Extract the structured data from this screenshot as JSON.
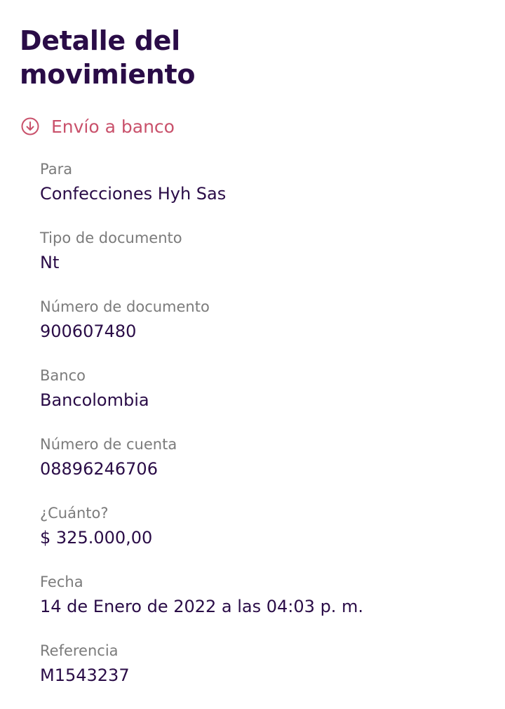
{
  "header": {
    "title_line1": "Detalle del",
    "title_line2": "movimiento"
  },
  "movement": {
    "icon": "arrow-down-circle-icon",
    "label": "Envío a banco",
    "accent_color": "#c9516b"
  },
  "fields": [
    {
      "label": "Para",
      "value": "Confecciones Hyh Sas"
    },
    {
      "label": "Tipo de documento",
      "value": "Nt"
    },
    {
      "label": "Número de documento",
      "value": "900607480"
    },
    {
      "label": "Banco",
      "value": "Bancolombia"
    },
    {
      "label": "Número de cuenta",
      "value": "08896246706"
    },
    {
      "label": "¿Cuánto?",
      "value": "$ 325.000,00"
    },
    {
      "label": "Fecha",
      "value": "14 de Enero de 2022 a las 04:03 p. m."
    },
    {
      "label": "Referencia",
      "value": "M1543237"
    }
  ]
}
